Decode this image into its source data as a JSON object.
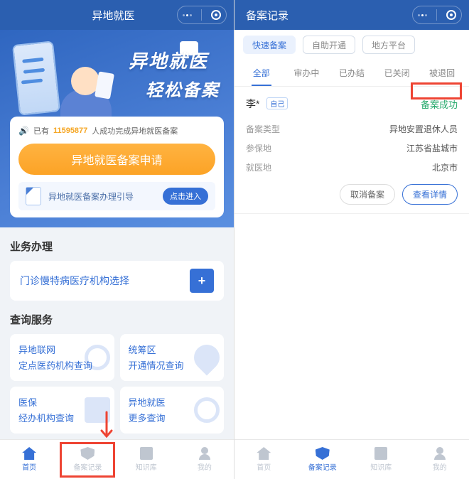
{
  "left": {
    "title": "异地就医",
    "hero": {
      "headline_l1": "异地就医",
      "headline_l2": "轻松备案",
      "stat_prefix": "已有",
      "stat_count": "11595877",
      "stat_suffix": "人成功完成异地就医备案",
      "cta": "异地就医备案申请",
      "guide_text": "异地就医备案办理引导",
      "guide_btn": "点击进入"
    },
    "section_biz": "业务办理",
    "tile_clinic": "门诊慢特病医疗机构选择",
    "section_query": "查询服务",
    "tiles": [
      {
        "t1": "异地联网",
        "t2": "定点医药机构查询"
      },
      {
        "t1": "统筹区",
        "t2": "开通情况查询"
      },
      {
        "t1": "医保",
        "t2": "经办机构查询"
      },
      {
        "t1": "异地就医",
        "t2": "更多查询"
      }
    ],
    "tabs": [
      "首页",
      "备案记录",
      "知识库",
      "我的"
    ]
  },
  "right": {
    "title": "备案记录",
    "top_chips": [
      "快速备案",
      "自助开通",
      "地方平台"
    ],
    "filter_tabs": [
      "全部",
      "审办中",
      "已办结",
      "已关闭",
      "被退回"
    ],
    "record": {
      "name": "李*",
      "self_tag": "自己",
      "status": "备案成功",
      "rows": [
        {
          "k": "备案类型",
          "v": "异地安置退休人员"
        },
        {
          "k": "参保地",
          "v": "江苏省盐城市"
        },
        {
          "k": "就医地",
          "v": "北京市"
        }
      ],
      "actions": {
        "cancel": "取消备案",
        "detail": "查看详情"
      }
    },
    "tabs": [
      "首页",
      "备案记录",
      "知识库",
      "我的"
    ]
  }
}
